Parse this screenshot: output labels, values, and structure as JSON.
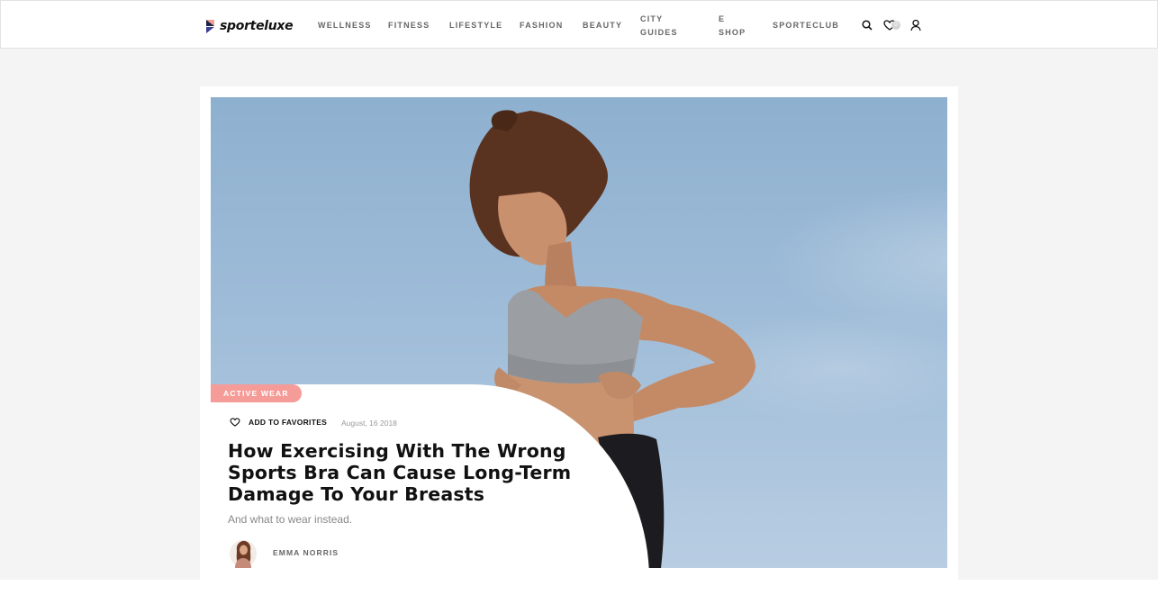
{
  "brand": {
    "name": "sporteluxe"
  },
  "nav": {
    "items": [
      {
        "lines": [
          "WELLNESS"
        ]
      },
      {
        "lines": [
          "FITNESS"
        ]
      },
      {
        "lines": [
          "LIFESTYLE"
        ]
      },
      {
        "lines": [
          "FASHION"
        ]
      },
      {
        "lines": [
          "BEAUTY"
        ]
      },
      {
        "lines": [
          "CITY",
          "GUIDES"
        ]
      },
      {
        "lines": [
          "E",
          "SHOP"
        ]
      },
      {
        "lines": [
          "SPORTECLUB"
        ]
      }
    ],
    "favorites_count": "0",
    "icons": [
      "search-icon",
      "heart-icon",
      "user-icon"
    ]
  },
  "article": {
    "category": "ACTIVE WEAR",
    "favorite_label": "ADD TO FAVORITES",
    "date": "August, 16 2018",
    "title": "How Exercising With The Wrong Sports Bra Can Cause Long-Term Damage To Your Breasts",
    "subtitle": "And what to wear instead.",
    "author": "EMMA NORRIS"
  },
  "colors": {
    "accent": "#f69c98",
    "sky": "#9ebcd8",
    "text": "#111111",
    "muted": "#888888"
  }
}
